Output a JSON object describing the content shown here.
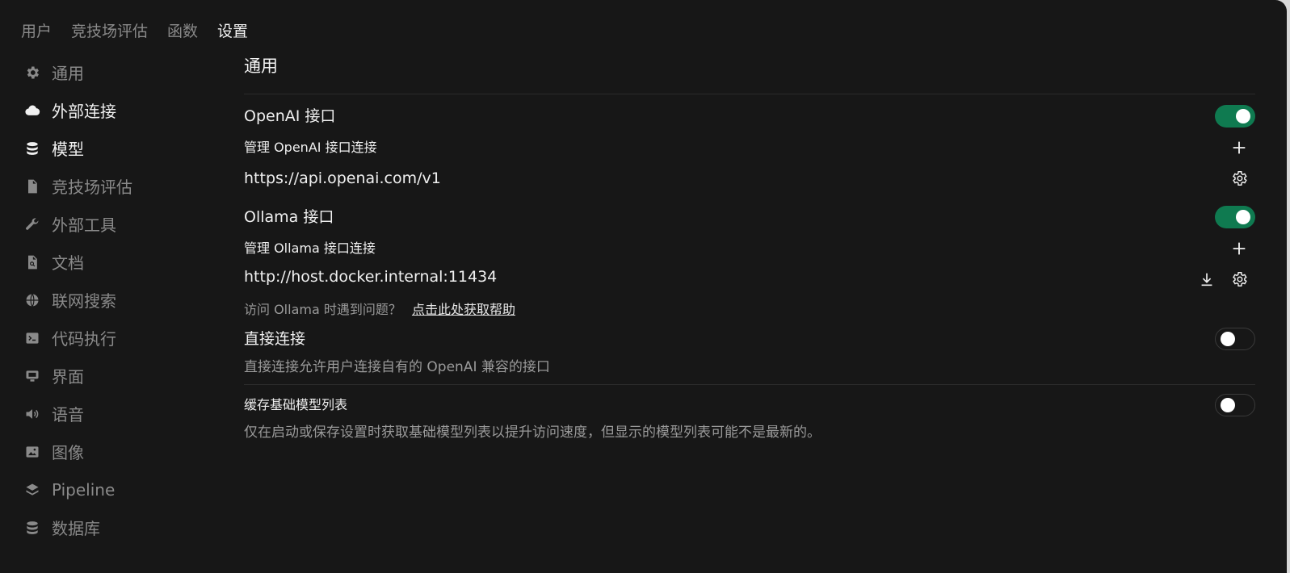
{
  "topnav": {
    "items": [
      "用户",
      "竞技场评估",
      "函数",
      "设置"
    ],
    "active_index": 3
  },
  "sidebar": {
    "items": [
      {
        "label": "通用",
        "icon": "gear-icon"
      },
      {
        "label": "外部连接",
        "icon": "cloud-icon"
      },
      {
        "label": "模型",
        "icon": "database-icon"
      },
      {
        "label": "竞技场评估",
        "icon": "document-chart-icon"
      },
      {
        "label": "外部工具",
        "icon": "wrench-icon"
      },
      {
        "label": "文档",
        "icon": "document-search-icon"
      },
      {
        "label": "联网搜索",
        "icon": "globe-icon"
      },
      {
        "label": "代码执行",
        "icon": "terminal-icon"
      },
      {
        "label": "界面",
        "icon": "monitor-icon"
      },
      {
        "label": "语音",
        "icon": "speaker-icon"
      },
      {
        "label": "图像",
        "icon": "image-icon"
      },
      {
        "label": "Pipeline",
        "icon": "layers-icon"
      },
      {
        "label": "数据库",
        "icon": "database-icon"
      }
    ],
    "active_labels": [
      "外部连接",
      "模型"
    ]
  },
  "main": {
    "section_title": "通用",
    "openai": {
      "title": "OpenAI 接口",
      "enabled": true,
      "manage_label": "管理 OpenAI 接口连接",
      "url": "https://api.openai.com/v1"
    },
    "ollama": {
      "title": "Ollama 接口",
      "enabled": true,
      "manage_label": "管理 Ollama 接口连接",
      "url": "http://host.docker.internal:11434",
      "help_prefix": "访问 Ollama 时遇到问题？",
      "help_link": "点击此处获取帮助"
    },
    "direct": {
      "title": "直接连接",
      "enabled": false,
      "desc": "直接连接允许用户连接自有的 OpenAI 兼容的接口"
    },
    "cache": {
      "title": "缓存基础模型列表",
      "enabled": false,
      "desc": "仅在启动或保存设置时获取基础模型列表以提升访问速度，但显示的模型列表可能不是最新的。"
    }
  },
  "colors": {
    "background": "#171717",
    "toggle_on": "#0f7a50",
    "text_primary": "#f0f0f0",
    "text_muted": "#8a8a8a"
  }
}
